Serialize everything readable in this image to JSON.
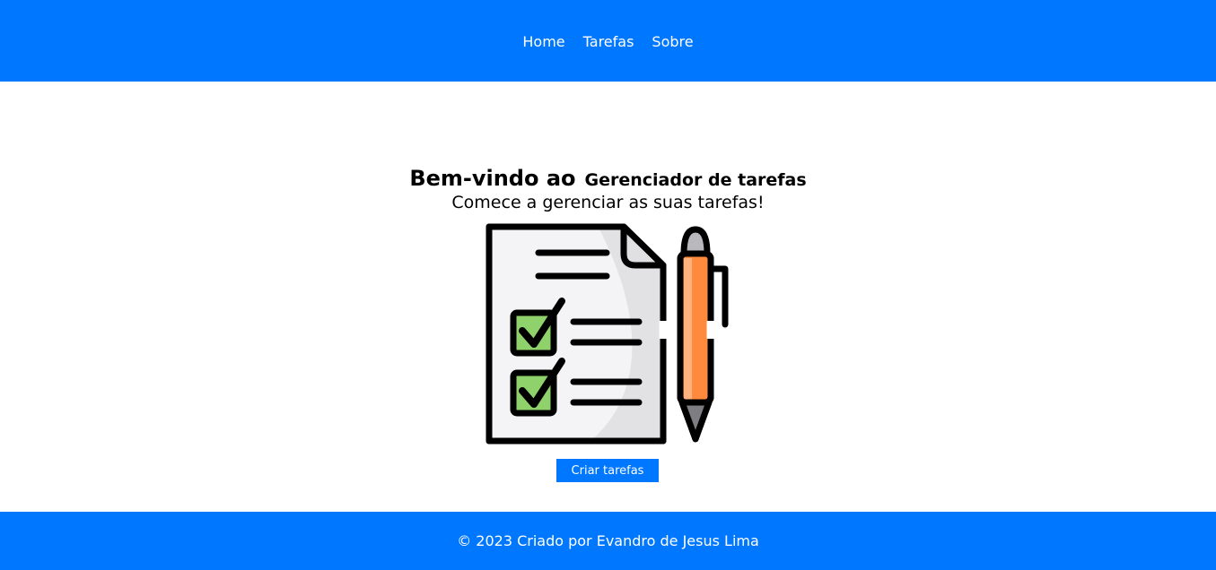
{
  "nav": {
    "items": [
      {
        "label": "Home"
      },
      {
        "label": "Tarefas"
      },
      {
        "label": "Sobre"
      }
    ]
  },
  "hero": {
    "title_main": "Bem-vindo ao",
    "title_accent": "Gerenciador de tarefas",
    "subtitle": "Comece a gerenciar as suas tarefas!",
    "illustration": "checklist-and-pen-icon",
    "button_label": "Criar tarefas"
  },
  "footer": {
    "text": "© 2023 Criado por Evandro de Jesus Lima"
  },
  "colors": {
    "primary": "#0077ff",
    "background": "#ffffff",
    "checkbox_green": "#8fd16a",
    "pen_orange": "#ff8a3d"
  }
}
